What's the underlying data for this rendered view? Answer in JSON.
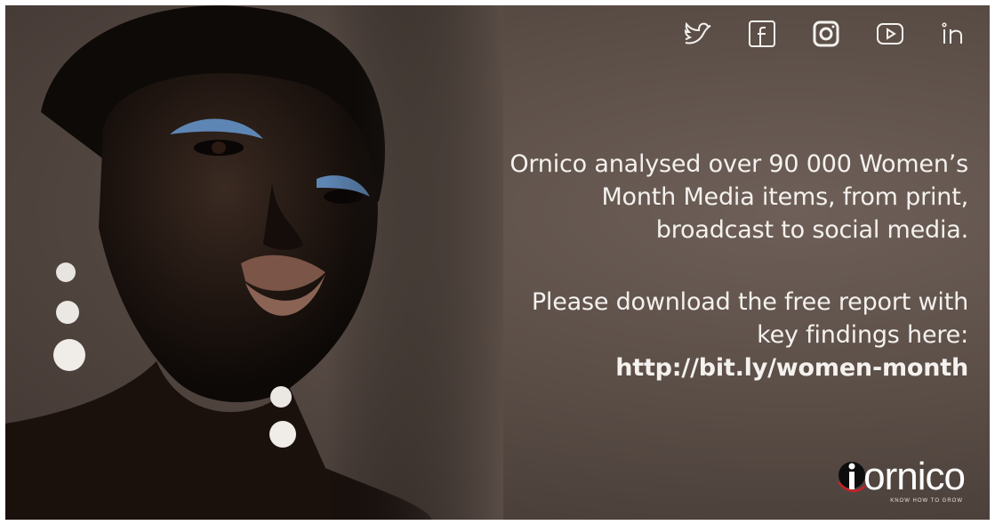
{
  "socials": [
    {
      "name": "twitter-icon"
    },
    {
      "name": "facebook-icon"
    },
    {
      "name": "instagram-icon"
    },
    {
      "name": "youtube-icon"
    },
    {
      "name": "linkedin-icon"
    }
  ],
  "headline": {
    "line1": "Ornico analysed over 90 000 Women’s",
    "line2": "Month Media items, from print,",
    "line3": "broadcast to social media."
  },
  "cta": {
    "line1": "Please download the free report with",
    "line2": "key findings here:",
    "link": "http://bit.ly/women-month"
  },
  "logo": {
    "word": "ornico",
    "tagline": "KNOW HOW TO GROW",
    "accent_color": "#c8202a"
  },
  "colors": {
    "background": "#5a4d46",
    "text": "#f4f1ee"
  }
}
